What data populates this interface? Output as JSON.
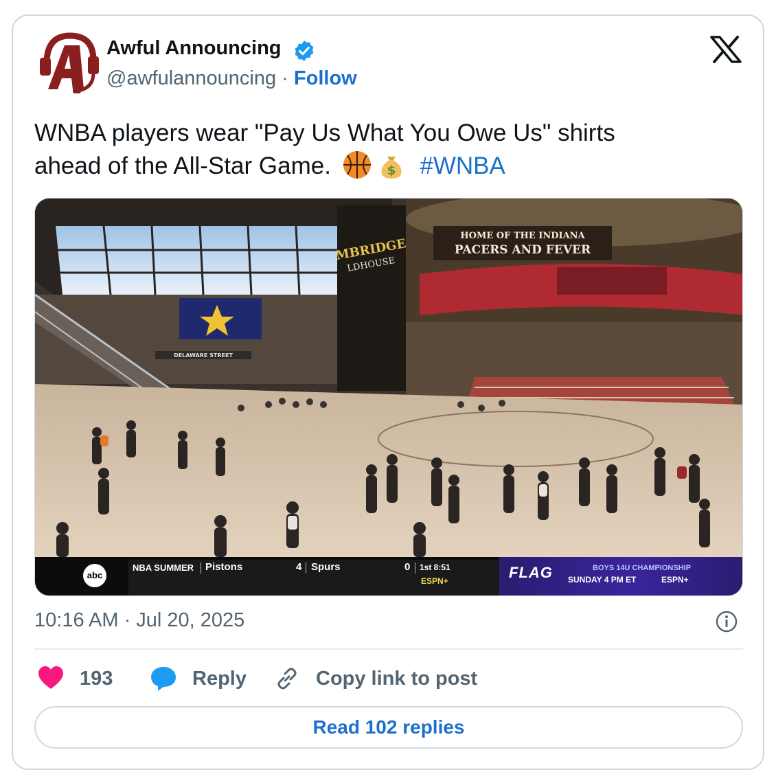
{
  "author": {
    "name": "Awful Announcing",
    "handle": "@awfulannouncing",
    "separator": "·",
    "follow_label": "Follow",
    "avatar_icon": "awful-announcing-logo",
    "verified_icon": "verified-badge-icon",
    "verified_color": "#1d9bf0"
  },
  "platform_icon": "x-logo-icon",
  "tweet": {
    "text_line1": "WNBA players wear \"Pay Us What You Owe Us\" shirts",
    "text_line2": "ahead of the All-Star Game.",
    "emojis": [
      "basketball-emoji",
      "money-bag-emoji"
    ],
    "hashtag": "#WNBA",
    "link_color": "#1d6fce"
  },
  "media": {
    "signs": {
      "arena_sign_line1": "HOME OF THE INDIANA",
      "arena_sign_line2": "PACERS AND FEVER",
      "arena_name_line1": "MBRIDGE",
      "arena_name_line2": "LDHOUSE",
      "street_sign": "DELAWARE STREET"
    },
    "ticker": {
      "network": "abc",
      "league": "NBA SUMMER",
      "team1": "Pistons",
      "score1": "4",
      "team2": "Spurs",
      "score2": "0",
      "clock": "1st 8:51",
      "channel": "ESPN+",
      "promo_brand": "FLAG",
      "promo_line1": "BOYS 14U CHAMPIONSHIP",
      "promo_line2": "SUNDAY 4 PM ET",
      "promo_networks": "ESPN+"
    }
  },
  "timestamp": "10:16 AM · Jul 20, 2025",
  "info_icon": "info-icon",
  "actions": {
    "likes_count": "193",
    "like_color": "#f91880",
    "reply_label": "Reply",
    "reply_color": "#1d9bf0",
    "copy_label": "Copy link to post"
  },
  "read_replies_label": "Read 102 replies"
}
